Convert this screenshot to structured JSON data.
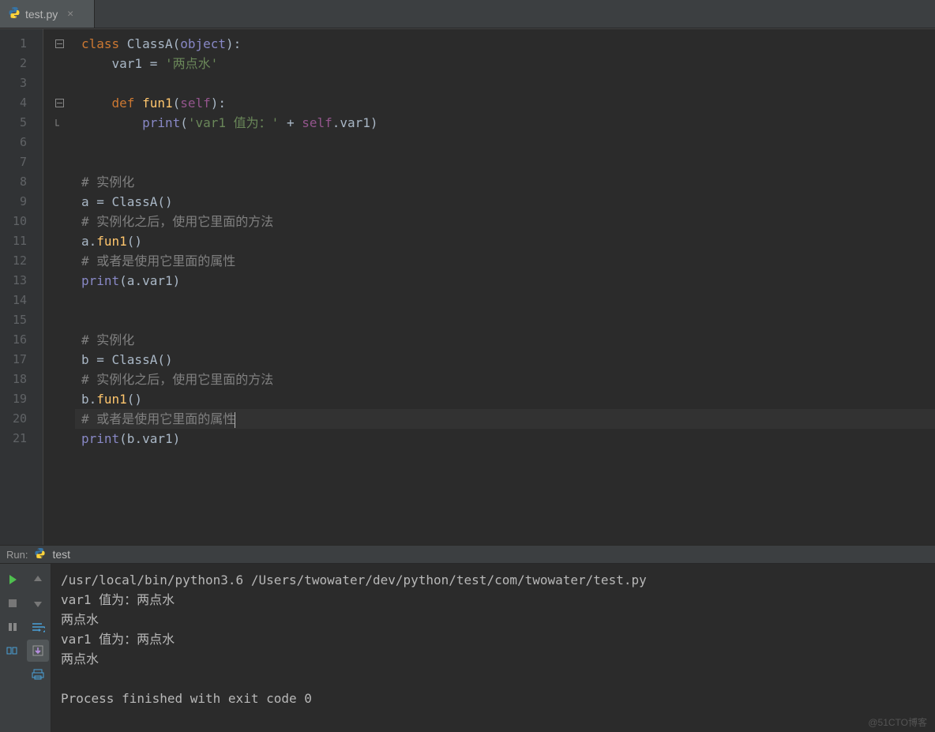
{
  "tab": {
    "label": "test.py"
  },
  "editor": {
    "lineNumbers": [
      "1",
      "2",
      "3",
      "4",
      "5",
      "6",
      "7",
      "8",
      "9",
      "10",
      "11",
      "12",
      "13",
      "14",
      "15",
      "16",
      "17",
      "18",
      "19",
      "20",
      "21"
    ],
    "currentLine": 20,
    "code": {
      "l1": {
        "kw1": "class ",
        "cls": "ClassA",
        "p1": "(",
        "b": "object",
        "p2": "):"
      },
      "l2": {
        "ind": "    ",
        "v": "var1 = ",
        "s": "'两点水'"
      },
      "l3": "",
      "l4": {
        "ind": "    ",
        "kw": "def ",
        "fn": "fun1",
        "p1": "(",
        "self": "self",
        "p2": "):"
      },
      "l5": {
        "ind": "        ",
        "pr": "print",
        "p1": "(",
        "s1": "'var1 值为：'",
        "plus": " + ",
        "self": "self",
        "dot": ".var1)"
      },
      "l6": "",
      "l7": "",
      "l8": {
        "c": "# 实例化"
      },
      "l9": {
        "t": "a = ClassA()"
      },
      "l10": {
        "c": "# 实例化之后，使用它里面的方法"
      },
      "l11": {
        "t1": "a.",
        "fn": "fun1",
        "t2": "()"
      },
      "l12": {
        "c": "# 或者是使用它里面的属性"
      },
      "l13": {
        "pr": "print",
        "t": "(a.var1)"
      },
      "l14": "",
      "l15": "",
      "l16": {
        "c": "# 实例化"
      },
      "l17": {
        "t": "b = ClassA()"
      },
      "l18": {
        "c": "# 实例化之后，使用它里面的方法"
      },
      "l19": {
        "t1": "b.",
        "fn": "fun1",
        "t2": "()"
      },
      "l20": {
        "c": "# 或者是使用它里面的属性"
      },
      "l21": {
        "pr": "print",
        "t": "(b.var1)"
      }
    }
  },
  "run": {
    "label": "Run:",
    "title": "test",
    "output": [
      "/usr/local/bin/python3.6 /Users/twowater/dev/python/test/com/twowater/test.py",
      "var1 值为：两点水",
      "两点水",
      "var1 值为：两点水",
      "两点水",
      "",
      "Process finished with exit code 0"
    ]
  },
  "watermark": "@51CTO博客"
}
